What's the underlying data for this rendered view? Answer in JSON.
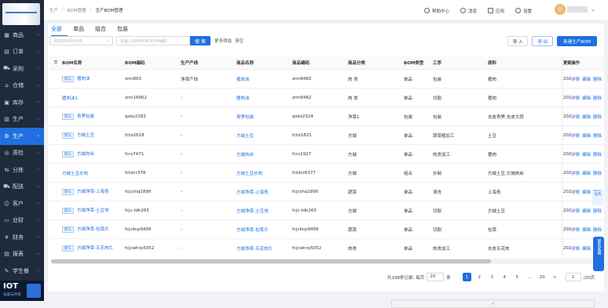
{
  "sidebar": {
    "items": [
      {
        "icon": "grid-icon",
        "label": "商品"
      },
      {
        "icon": "order-icon",
        "label": "订单"
      },
      {
        "icon": "cart-icon",
        "label": "采购"
      },
      {
        "icon": "warehouse-icon",
        "label": "仓储"
      },
      {
        "icon": "box-icon",
        "label": "库存"
      },
      {
        "icon": "factory-icon",
        "label": "生产"
      },
      {
        "icon": "production-icon",
        "label": "生产",
        "active": true
      },
      {
        "icon": "quality-icon",
        "label": "质检"
      },
      {
        "icon": "split-icon",
        "label": "分拣"
      },
      {
        "icon": "truck-icon",
        "label": "配送"
      },
      {
        "icon": "user-icon",
        "label": "客户"
      },
      {
        "icon": "wallet-icon",
        "label": "业财"
      },
      {
        "icon": "finance-icon",
        "label": "财务"
      },
      {
        "icon": "report-icon",
        "label": "报表"
      },
      {
        "icon": "student-icon",
        "label": "学生餐"
      }
    ],
    "footer": {
      "title": "IOT",
      "subtitle": "设备与环境"
    }
  },
  "breadcrumb": [
    "生产",
    "BOM管理",
    "生产BOM管理"
  ],
  "topbar": {
    "help": "帮助中心",
    "messages": "消息",
    "apps": "应用",
    "settings": "设置"
  },
  "tabs": [
    "全部",
    "单品",
    "组合",
    "包装"
  ],
  "filters": {
    "select_placeholder": "请选择BOM分类",
    "search_placeholder": "请输入BOM名称/BOM编码",
    "search_button": "搜 索",
    "more": "更多筛选",
    "clear": "清空"
  },
  "buttons": {
    "import": "导 入",
    "export": "导 出",
    "new": "新建生产BOM"
  },
  "columns": [
    "BOM名称",
    "BOM编码",
    "生产产线",
    "商品名称",
    "商品编码",
    "商品分类",
    "BOM类型",
    "工序",
    "原料",
    "更新",
    "操作"
  ],
  "rows": [
    {
      "default": true,
      "name": "猪肉沫",
      "code": "zrm803",
      "line": "净菜产线",
      "product": "猪肉沫",
      "pcode": "zrm8482",
      "category": "肉 类",
      "type": "单品",
      "process": "包装",
      "material": "猪肉",
      "updated": "202"
    },
    {
      "default": false,
      "name": "猪肉沫1",
      "code": "zrm16662",
      "line": "-",
      "product": "猪肉沫",
      "pcode": "zrm8482",
      "category": "肉 类",
      "type": "单品",
      "process": "切割",
      "material": "猪肉",
      "updated": "202"
    },
    {
      "default": true,
      "name": "青笋包装",
      "code": "qsbz2183",
      "line": "-",
      "product": "青笋包装",
      "pcode": "qsbz2324",
      "category": "净菜1",
      "type": "包装",
      "process": "包装",
      "material": "去皮青笋,去皮大蒜",
      "updated": "202"
    },
    {
      "default": true,
      "name": "方城土豆",
      "code": "fctd2618",
      "line": "-",
      "product": "方城土豆",
      "pcode": "fctd1821",
      "category": "方城",
      "type": "单品",
      "process": "蔬菜粗加工",
      "material": "土豆",
      "updated": "202"
    },
    {
      "default": true,
      "name": "方城肉丝",
      "code": "fcrs7471",
      "line": "-",
      "product": "方城肉丝",
      "pcode": "fcrs1927",
      "category": "方城",
      "type": "单品",
      "process": "肉类加工",
      "material": "猪肉",
      "updated": "202"
    },
    {
      "default": false,
      "name": "方城土豆炒肉",
      "code": "fctdcr378",
      "line": "-",
      "product": "方城土豆炒肉",
      "pcode": "fctdcr6377",
      "category": "方城",
      "type": "组合",
      "process": "炒制",
      "material": "方城土豆,方城肉丝",
      "updated": "202"
    },
    {
      "default": true,
      "name": "方城净菜-上海青",
      "code": "fcjcshq1890",
      "line": "-",
      "product": "方城净菜-上海青",
      "pcode": "fcjcshq1890",
      "category": "蔬菜",
      "type": "单品",
      "process": "清洗",
      "material": "上海青",
      "updated": "202"
    },
    {
      "default": true,
      "name": "方城净菜-土豆块",
      "code": "fcjc-tdk265",
      "line": "-",
      "product": "方城净菜-土豆块",
      "pcode": "fcjc-tdk265",
      "category": "方城",
      "type": "单品",
      "process": "切割",
      "material": "方城土豆",
      "updated": "202"
    },
    {
      "default": true,
      "name": "方城净菜-包菜片",
      "code": "fcjcbcp9499",
      "line": "-",
      "product": "方城净菜-包菜片",
      "pcode": "fcjcbcp9499",
      "category": "蔬菜",
      "type": "单品",
      "process": "切割",
      "material": "包菜",
      "updated": "202"
    },
    {
      "default": true,
      "name": "方城净菜-五花肉片",
      "code": "fcjcwhrp5052",
      "line": "-",
      "product": "方城净菜-五花肉片",
      "pcode": "fcjcwhrp5052",
      "category": "肉类",
      "type": "单品",
      "process": "肉类加工",
      "material": "去皮五花肉",
      "updated": "202"
    }
  ],
  "row_actions": [
    "详情",
    "编辑",
    "删除"
  ],
  "default_tag": "默认",
  "pagination": {
    "total_text": "共198条记录,",
    "per_page_label": "每页",
    "per_page": "20",
    "unit": "条",
    "pages": [
      "1",
      "2",
      "3",
      "4",
      "5",
      "...",
      "20"
    ],
    "current": "1",
    "jump_value": "1",
    "total_pages": "/20页",
    "prev": "<",
    "next": ">"
  },
  "float": {
    "tasks": "任务",
    "help": "联系客服"
  }
}
